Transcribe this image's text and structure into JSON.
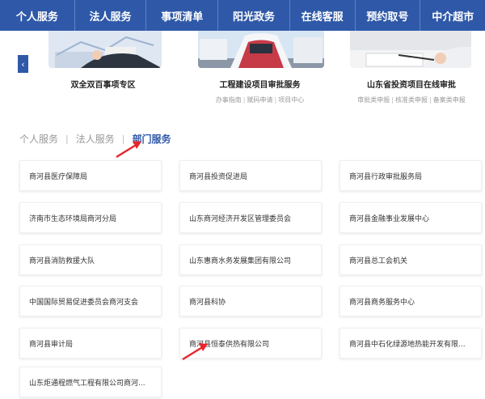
{
  "nav": {
    "items": [
      {
        "label": "个人服务",
        "width": 92
      },
      {
        "label": "法人服务",
        "width": 88
      },
      {
        "label": "事项清单",
        "width": 88
      },
      {
        "label": "阳光政务",
        "width": 88
      },
      {
        "label": "在线客服",
        "width": 80
      },
      {
        "label": "预约取号",
        "width": 80
      },
      {
        "label": "中介超市",
        "width": 80
      }
    ]
  },
  "carousel": {
    "cards": [
      {
        "title": "双全双百事项专区",
        "links": []
      },
      {
        "title": "工程建设项目审批服务",
        "links": [
          "办事指南",
          "赋码申请",
          "项目中心"
        ]
      },
      {
        "title": "山东省投资项目在线审批",
        "links": [
          "审批类申报",
          "核准类申报",
          "备案类申报"
        ]
      }
    ]
  },
  "tabs": {
    "personal": "个人服务",
    "legal": "法人服务",
    "department": "部门服务",
    "separator": "|"
  },
  "departments": [
    "商河县医疗保障局",
    "商河县投资促进局",
    "商河县行政审批服务局",
    "济南市生态环境局商河分局",
    "山东商河经济开发区管理委员会",
    "商河县金融事业发展中心",
    "商河县消防救援大队",
    "山东惠商水务发展集团有限公司",
    "商河县总工会机关",
    "中国国际贸易促进委员会商河支会",
    "商河县科协",
    "商河县商务服务中心",
    "商河县审计局",
    "商河县恒泰供热有限公司",
    "商河县中石化绿源地热能开发有限...",
    "山东炬通程燃气工程有限公司商河..."
  ],
  "colors": {
    "nav_bg": "#2f59a8",
    "accent": "#2f59a8",
    "annotation": "#e8242a"
  }
}
